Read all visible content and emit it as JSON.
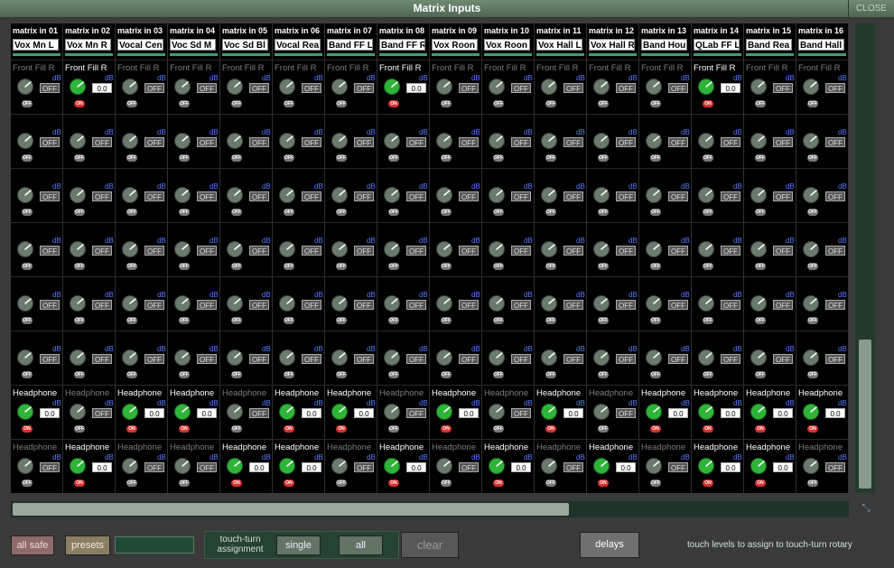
{
  "window": {
    "title": "Matrix Inputs",
    "close_label": "CLOSE"
  },
  "units": {
    "db": "dB",
    "off": "OFF",
    "zero": "0.0",
    "on": "ON"
  },
  "columns": [
    {
      "channel": "matrix in 01",
      "name": "Vox Mn L"
    },
    {
      "channel": "matrix in 02",
      "name": "Vox Mn R"
    },
    {
      "channel": "matrix in 03",
      "name": "Vocal Cen"
    },
    {
      "channel": "matrix in 04",
      "name": "Voc Sd M"
    },
    {
      "channel": "matrix in 05",
      "name": "Voc Sd Bl"
    },
    {
      "channel": "matrix in 06",
      "name": "Vocal Rea"
    },
    {
      "channel": "matrix in 07",
      "name": "Band FF L"
    },
    {
      "channel": "matrix in 08",
      "name": "Band FF R"
    },
    {
      "channel": "matrix in 09",
      "name": "Vox Roon"
    },
    {
      "channel": "matrix in 10",
      "name": "Vox Roon"
    },
    {
      "channel": "matrix in 11",
      "name": "Vox Hall L"
    },
    {
      "channel": "matrix in 12",
      "name": "Vox Hall R"
    },
    {
      "channel": "matrix in 13",
      "name": "Band Hou"
    },
    {
      "channel": "matrix in 14",
      "name": "QLab FF L"
    },
    {
      "channel": "matrix in 15",
      "name": "Band Rea"
    },
    {
      "channel": "matrix in 16",
      "name": "Band Hall"
    }
  ],
  "rows": [
    {
      "label": "Front Fill R",
      "active": [
        2,
        8,
        14
      ]
    },
    {
      "label": "",
      "active": []
    },
    {
      "label": "",
      "active": []
    },
    {
      "label": "",
      "active": []
    },
    {
      "label": "",
      "active": []
    },
    {
      "label": "",
      "active": []
    },
    {
      "label": "Headphone",
      "active": [
        1,
        3,
        4,
        6,
        7,
        9,
        11,
        13,
        14,
        15,
        16
      ]
    },
    {
      "label": "Headphone",
      "active": [
        2,
        5,
        6,
        8,
        10,
        12,
        14,
        15
      ]
    }
  ],
  "toolbar": {
    "all_safe": "all safe",
    "presets": "presets",
    "touch_turn_label": "touch-turn assignment",
    "single": "single",
    "all": "all",
    "clear": "clear",
    "delays": "delays",
    "hint": "touch levels to assign to touch-turn rotary"
  },
  "colors": {
    "accent": "#3ea072",
    "knob_on": "#2fb43a",
    "knob_off": "#6a7a6c",
    "pill_on": "#d63030"
  }
}
